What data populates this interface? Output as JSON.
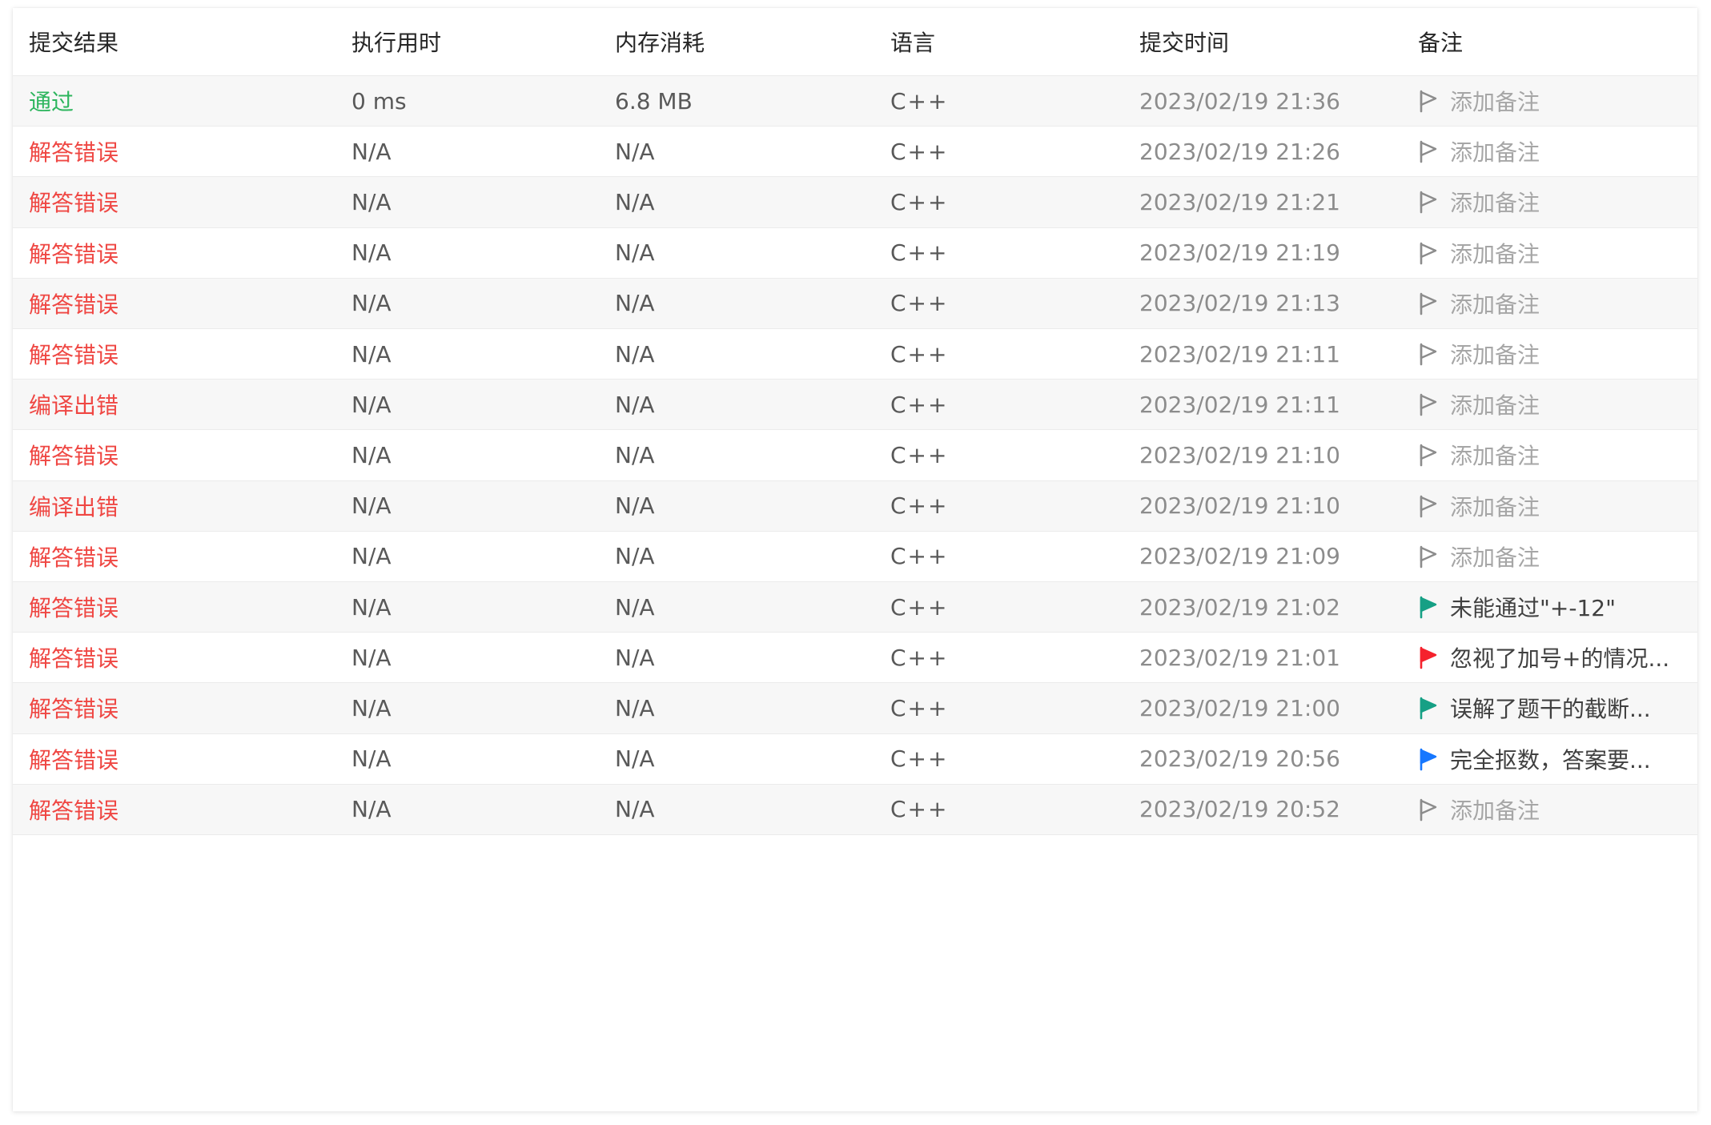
{
  "table": {
    "headers": {
      "result": "提交结果",
      "runtime": "执行用时",
      "memory": "内存消耗",
      "language": "语言",
      "submit_time": "提交时间",
      "note": "备注"
    },
    "rows": [
      {
        "result": "通过",
        "status": "accepted",
        "runtime": "0 ms",
        "memory": "6.8 MB",
        "language": "C++",
        "submit_time": "2023/02/19 21:36",
        "note": "添加备注",
        "note_flag": "none"
      },
      {
        "result": "解答错误",
        "status": "error",
        "runtime": "N/A",
        "memory": "N/A",
        "language": "C++",
        "submit_time": "2023/02/19 21:26",
        "note": "添加备注",
        "note_flag": "none"
      },
      {
        "result": "解答错误",
        "status": "error",
        "runtime": "N/A",
        "memory": "N/A",
        "language": "C++",
        "submit_time": "2023/02/19 21:21",
        "note": "添加备注",
        "note_flag": "none"
      },
      {
        "result": "解答错误",
        "status": "error",
        "runtime": "N/A",
        "memory": "N/A",
        "language": "C++",
        "submit_time": "2023/02/19 21:19",
        "note": "添加备注",
        "note_flag": "none"
      },
      {
        "result": "解答错误",
        "status": "error",
        "runtime": "N/A",
        "memory": "N/A",
        "language": "C++",
        "submit_time": "2023/02/19 21:13",
        "note": "添加备注",
        "note_flag": "none"
      },
      {
        "result": "解答错误",
        "status": "error",
        "runtime": "N/A",
        "memory": "N/A",
        "language": "C++",
        "submit_time": "2023/02/19 21:11",
        "note": "添加备注",
        "note_flag": "none"
      },
      {
        "result": "编译出错",
        "status": "error",
        "runtime": "N/A",
        "memory": "N/A",
        "language": "C++",
        "submit_time": "2023/02/19 21:11",
        "note": "添加备注",
        "note_flag": "none"
      },
      {
        "result": "解答错误",
        "status": "error",
        "runtime": "N/A",
        "memory": "N/A",
        "language": "C++",
        "submit_time": "2023/02/19 21:10",
        "note": "添加备注",
        "note_flag": "none"
      },
      {
        "result": "编译出错",
        "status": "error",
        "runtime": "N/A",
        "memory": "N/A",
        "language": "C++",
        "submit_time": "2023/02/19 21:10",
        "note": "添加备注",
        "note_flag": "none"
      },
      {
        "result": "解答错误",
        "status": "error",
        "runtime": "N/A",
        "memory": "N/A",
        "language": "C++",
        "submit_time": "2023/02/19 21:09",
        "note": "添加备注",
        "note_flag": "none"
      },
      {
        "result": "解答错误",
        "status": "error",
        "runtime": "N/A",
        "memory": "N/A",
        "language": "C++",
        "submit_time": "2023/02/19 21:02",
        "note": "未能通过\"+-12\"",
        "note_flag": "#16a085"
      },
      {
        "result": "解答错误",
        "status": "error",
        "runtime": "N/A",
        "memory": "N/A",
        "language": "C++",
        "submit_time": "2023/02/19 21:01",
        "note": "忽视了加号+的情况...",
        "note_flag": "#f5222d"
      },
      {
        "result": "解答错误",
        "status": "error",
        "runtime": "N/A",
        "memory": "N/A",
        "language": "C++",
        "submit_time": "2023/02/19 21:00",
        "note": "误解了题干的截断...",
        "note_flag": "#16a085"
      },
      {
        "result": "解答错误",
        "status": "error",
        "runtime": "N/A",
        "memory": "N/A",
        "language": "C++",
        "submit_time": "2023/02/19 20:56",
        "note": "完全抠数，答案要...",
        "note_flag": "#1677ff"
      },
      {
        "result": "解答错误",
        "status": "error",
        "runtime": "N/A",
        "memory": "N/A",
        "language": "C++",
        "submit_time": "2023/02/19 20:52",
        "note": "添加备注",
        "note_flag": "none"
      }
    ]
  },
  "colors": {
    "accepted": "#2db55d",
    "error": "#ef4743",
    "placeholder_flag": "#8c8c8c"
  },
  "icons": {
    "note_flag": "flag-icon"
  }
}
